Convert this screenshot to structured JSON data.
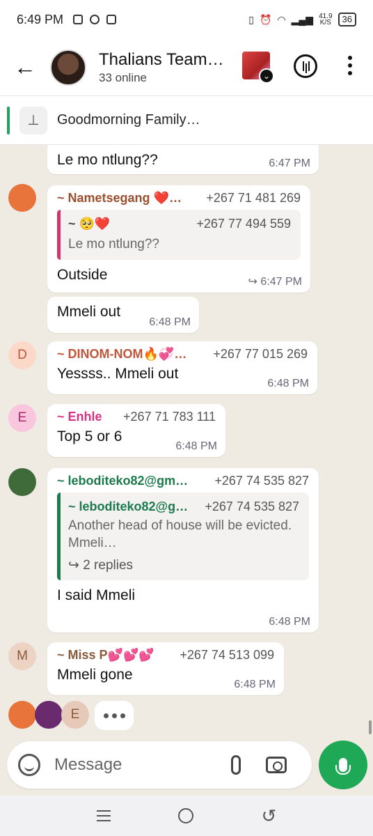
{
  "status_bar": {
    "time": "6:49 PM",
    "net_speed": "41.9",
    "net_unit": "K/S",
    "battery": "36"
  },
  "header": {
    "title": "Thalians Team…",
    "subtitle": "33 online"
  },
  "pinned": {
    "text": "Goodmorning Family…"
  },
  "messages": [
    {
      "text": "Le mo ntlung??",
      "time": "6:47 PM"
    },
    {
      "sender": "~ Nametsegang ❤️…",
      "sender_color": "#9a4f2e",
      "phone": "+267 71 481 269",
      "quote": {
        "name": "~ 🥺❤️",
        "phone": "+267 77 494 559",
        "text": "Le mo ntlung??",
        "color": "#d6336c"
      },
      "text": "Outside",
      "time": "6:47 PM"
    },
    {
      "text": "Mmeli out",
      "time": "6:48 PM"
    },
    {
      "sender": "~ DINOM-NOM🔥💞…",
      "sender_color": "#c0553a",
      "phone": "+267 77 015 269",
      "avatar_letter": "D",
      "avatar_bg": "#fbd8c7",
      "avatar_color": "#c0553a",
      "text": "Yessss.. Mmeli out",
      "time": "6:48 PM"
    },
    {
      "sender": "~ Enhle",
      "sender_color": "#d63384",
      "phone": "+267 71 783 111",
      "avatar_letter": "E",
      "avatar_bg": "#f9c6de",
      "avatar_color": "#b0246a",
      "text": "Top 5 or 6",
      "time": "6:48 PM"
    },
    {
      "sender": "~ leboditeko82@gm…",
      "sender_color": "#1c7a4d",
      "phone": "+267 74 535 827",
      "quote": {
        "name": "~ leboditeko82@g…",
        "phone": "+267 74 535 827",
        "text": "Another head of house will be evicted.",
        "text2": "Mmeli…",
        "replies": "2 replies",
        "color": "#1c7a4d"
      },
      "text": "I said Mmeli",
      "time": "6:48 PM"
    },
    {
      "sender": "~ Miss P💕💕💕",
      "sender_color": "#8a5a3a",
      "phone": "+267 74 513 099",
      "avatar_letter": "M",
      "avatar_bg": "#ecd3c4",
      "avatar_color": "#8a5a3a",
      "text": "Mmeli gone",
      "time": "6:48 PM"
    }
  ],
  "typing": {
    "avatar_letter": "E"
  },
  "composer": {
    "placeholder": "Message"
  },
  "icons": [
    "back-arrow-icon",
    "voice-chat-icon",
    "more-icon",
    "pin-icon",
    "emoji-icon",
    "attach-icon",
    "camera-icon",
    "mic-icon",
    "forward-icon"
  ]
}
